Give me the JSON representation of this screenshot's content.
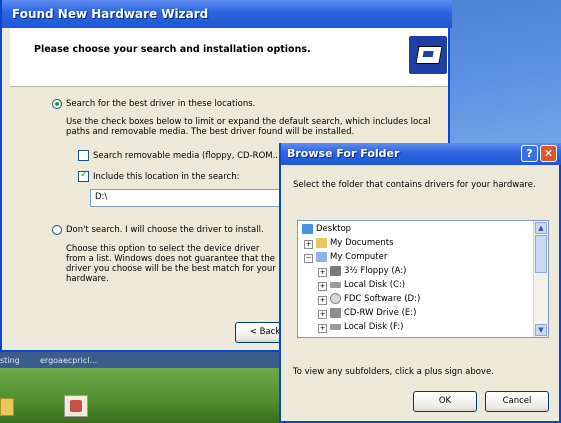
{
  "desktop": {
    "taskbar_left": "sting",
    "taskbar_right": "ergoaecpricl..."
  },
  "wizard": {
    "title": "Found New Hardware Wizard",
    "heading": "Please choose your search and installation options.",
    "option_search": "Search for the best driver in these locations.",
    "search_desc": "Use the check boxes below to limit or expand the default search, which includes local paths and removable media. The best driver found will be installed.",
    "check_removable": "Search removable media (floppy, CD-ROM...)",
    "check_include": "Include this location in the search:",
    "location_value": "D:\\",
    "option_dont_search": "Don't search. I will choose the driver to install.",
    "dont_search_desc": "Choose this option to select the device driver from a list. Windows does not guarantee that the driver you choose will be the best match for your hardware.",
    "back_button": "< Back"
  },
  "browse": {
    "title": "Browse For Folder",
    "help_label": "?",
    "close_label": "✕",
    "instruction": "Select the folder that contains drivers for your hardware.",
    "tree": {
      "desktop": "Desktop",
      "my_documents": "My Documents",
      "my_computer": "My Computer",
      "floppy": "3½ Floppy (A:)",
      "local_c": "Local Disk (C:)",
      "fdc": "FDC Software (D:)",
      "cdrw": "CD-RW Drive (E:)",
      "local_f": "Local Disk (F:)"
    },
    "hint": "To view any subfolders, click a plus sign above.",
    "ok_button": "OK",
    "cancel_button": "Cancel"
  }
}
